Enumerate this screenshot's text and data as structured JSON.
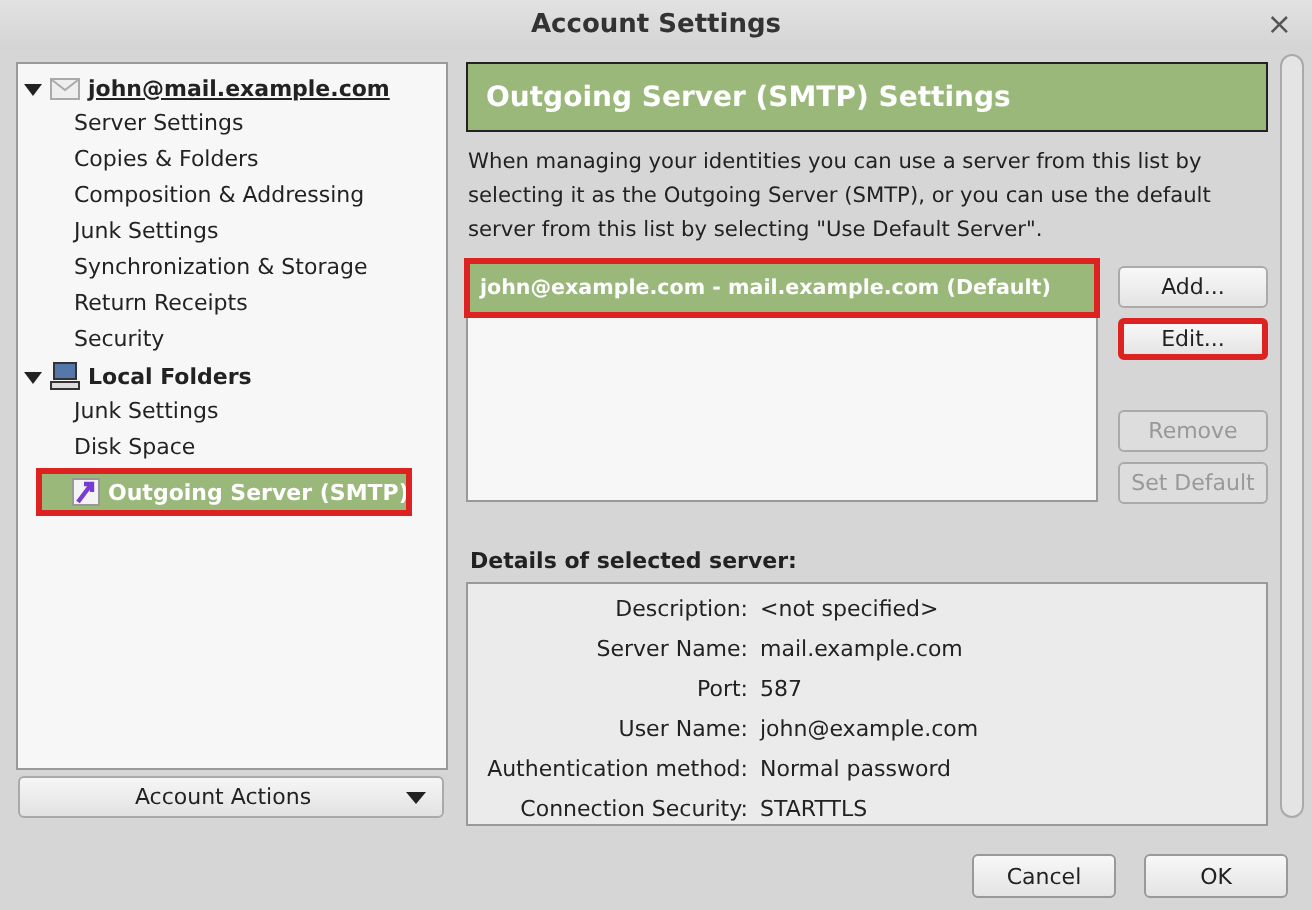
{
  "window": {
    "title": "Account Settings",
    "close": "×"
  },
  "tree": [
    {
      "label": "john@mail.example.com",
      "kind": "mail",
      "expanded": true,
      "selected": false,
      "highlighted": false,
      "children": [
        {
          "label": "Server Settings",
          "selected": false,
          "highlighted": false
        },
        {
          "label": "Copies & Folders",
          "selected": false,
          "highlighted": false
        },
        {
          "label": "Composition & Addressing",
          "selected": false,
          "highlighted": false
        },
        {
          "label": "Junk Settings",
          "selected": false,
          "highlighted": false
        },
        {
          "label": "Synchronization & Storage",
          "selected": false,
          "highlighted": false
        },
        {
          "label": "Return Receipts",
          "selected": false,
          "highlighted": false
        },
        {
          "label": "Security",
          "selected": false,
          "highlighted": false
        }
      ]
    },
    {
      "label": "Local Folders",
      "kind": "computer",
      "expanded": true,
      "selected": false,
      "highlighted": false,
      "children": [
        {
          "label": "Junk Settings",
          "selected": false,
          "highlighted": false
        },
        {
          "label": "Disk Space",
          "selected": false,
          "highlighted": false
        }
      ]
    },
    {
      "label": "Outgoing Server (SMTP)",
      "kind": "smtp",
      "selected": true,
      "highlighted": true
    }
  ],
  "account_actions": "Account Actions",
  "panel": {
    "heading": "Outgoing Server (SMTP) Settings",
    "description": "When managing your identities you can use a server from this list by selecting it as the Outgoing Server (SMTP), or you can use the default server from this list by selecting \"Use Default Server\".",
    "servers": [
      {
        "label": "john@example.com - mail.example.com (Default)",
        "selected": true,
        "highlighted": true
      }
    ],
    "button_groups": [
      [
        {
          "label": "Add...",
          "disabled": false,
          "highlighted": false
        },
        {
          "label": "Edit...",
          "disabled": false,
          "highlighted": true
        }
      ],
      [
        {
          "label": "Remove",
          "disabled": true,
          "highlighted": false
        },
        {
          "label": "Set Default",
          "disabled": true,
          "highlighted": false
        }
      ]
    ],
    "details_title": "Details of selected server:",
    "details": [
      {
        "label": "Description:",
        "value": "<not specified>"
      },
      {
        "label": "Server Name:",
        "value": "mail.example.com"
      },
      {
        "label": "Port:",
        "value": "587"
      },
      {
        "label": "User Name:",
        "value": "john@example.com"
      },
      {
        "label": "Authentication method:",
        "value": "Normal password"
      },
      {
        "label": "Connection Security:",
        "value": "STARTTLS"
      }
    ]
  },
  "footer_buttons": [
    "Cancel",
    "OK"
  ]
}
